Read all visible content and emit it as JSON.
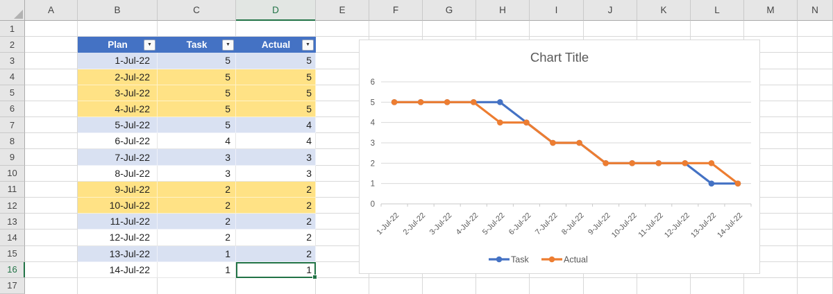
{
  "colors": {
    "table_header_blue": "#4472C4",
    "lavender": "#D9E1F2",
    "gold": "#FFE285",
    "accent_green": "#217346",
    "series_blue": "#4472C4",
    "series_orange": "#ED7D31",
    "chart_text_gray": "#595959",
    "gridline_gray": "#D9D9D9"
  },
  "icons": {
    "filter_arrow": "▼",
    "select_all_corner": "corner-triangle"
  },
  "grid": {
    "col_headers": [
      "A",
      "B",
      "C",
      "D",
      "E",
      "F",
      "G",
      "H",
      "I",
      "J",
      "K",
      "L",
      "M",
      "N"
    ],
    "row_headers": [
      "1",
      "2",
      "3",
      "4",
      "5",
      "6",
      "7",
      "8",
      "9",
      "10",
      "11",
      "12",
      "13",
      "14",
      "15",
      "16",
      "17"
    ]
  },
  "selection": {
    "active_cell": "D16",
    "column": "D",
    "row": "16"
  },
  "table": {
    "headers": [
      {
        "label": "Plan"
      },
      {
        "label": "Task"
      },
      {
        "label": "Actual"
      }
    ],
    "rows": [
      {
        "plan": "1-Jul-22",
        "task": 5,
        "actual": 5,
        "fill": "lavender"
      },
      {
        "plan": "2-Jul-22",
        "task": 5,
        "actual": 5,
        "fill": "gold"
      },
      {
        "plan": "3-Jul-22",
        "task": 5,
        "actual": 5,
        "fill": "gold"
      },
      {
        "plan": "4-Jul-22",
        "task": 5,
        "actual": 5,
        "fill": "gold"
      },
      {
        "plan": "5-Jul-22",
        "task": 5,
        "actual": 4,
        "fill": "lavender"
      },
      {
        "plan": "6-Jul-22",
        "task": 4,
        "actual": 4,
        "fill": "white"
      },
      {
        "plan": "7-Jul-22",
        "task": 3,
        "actual": 3,
        "fill": "lavender"
      },
      {
        "plan": "8-Jul-22",
        "task": 3,
        "actual": 3,
        "fill": "white"
      },
      {
        "plan": "9-Jul-22",
        "task": 2,
        "actual": 2,
        "fill": "gold"
      },
      {
        "plan": "10-Jul-22",
        "task": 2,
        "actual": 2,
        "fill": "gold"
      },
      {
        "plan": "11-Jul-22",
        "task": 2,
        "actual": 2,
        "fill": "lavender"
      },
      {
        "plan": "12-Jul-22",
        "task": 2,
        "actual": 2,
        "fill": "white"
      },
      {
        "plan": "13-Jul-22",
        "task": 1,
        "actual": 2,
        "fill": "lavender"
      },
      {
        "plan": "14-Jul-22",
        "task": 1,
        "actual": 1,
        "fill": "white"
      }
    ]
  },
  "chart_data": {
    "type": "line",
    "title": "Chart Title",
    "x": [
      "1-Jul-22",
      "2-Jul-22",
      "3-Jul-22",
      "4-Jul-22",
      "5-Jul-22",
      "6-Jul-22",
      "7-Jul-22",
      "8-Jul-22",
      "9-Jul-22",
      "10-Jul-22",
      "11-Jul-22",
      "12-Jul-22",
      "13-Jul-22",
      "14-Jul-22"
    ],
    "series": [
      {
        "name": "Task",
        "color": "#4472C4",
        "values": [
          5,
          5,
          5,
          5,
          5,
          4,
          3,
          3,
          2,
          2,
          2,
          2,
          1,
          1
        ]
      },
      {
        "name": "Actual",
        "color": "#ED7D31",
        "values": [
          5,
          5,
          5,
          5,
          4,
          4,
          3,
          3,
          2,
          2,
          2,
          2,
          2,
          1
        ]
      }
    ],
    "ylim": [
      0,
      6
    ],
    "yticks": [
      0,
      1,
      2,
      3,
      4,
      5,
      6
    ],
    "grid": true,
    "legend_position": "bottom",
    "marker": "circle"
  }
}
